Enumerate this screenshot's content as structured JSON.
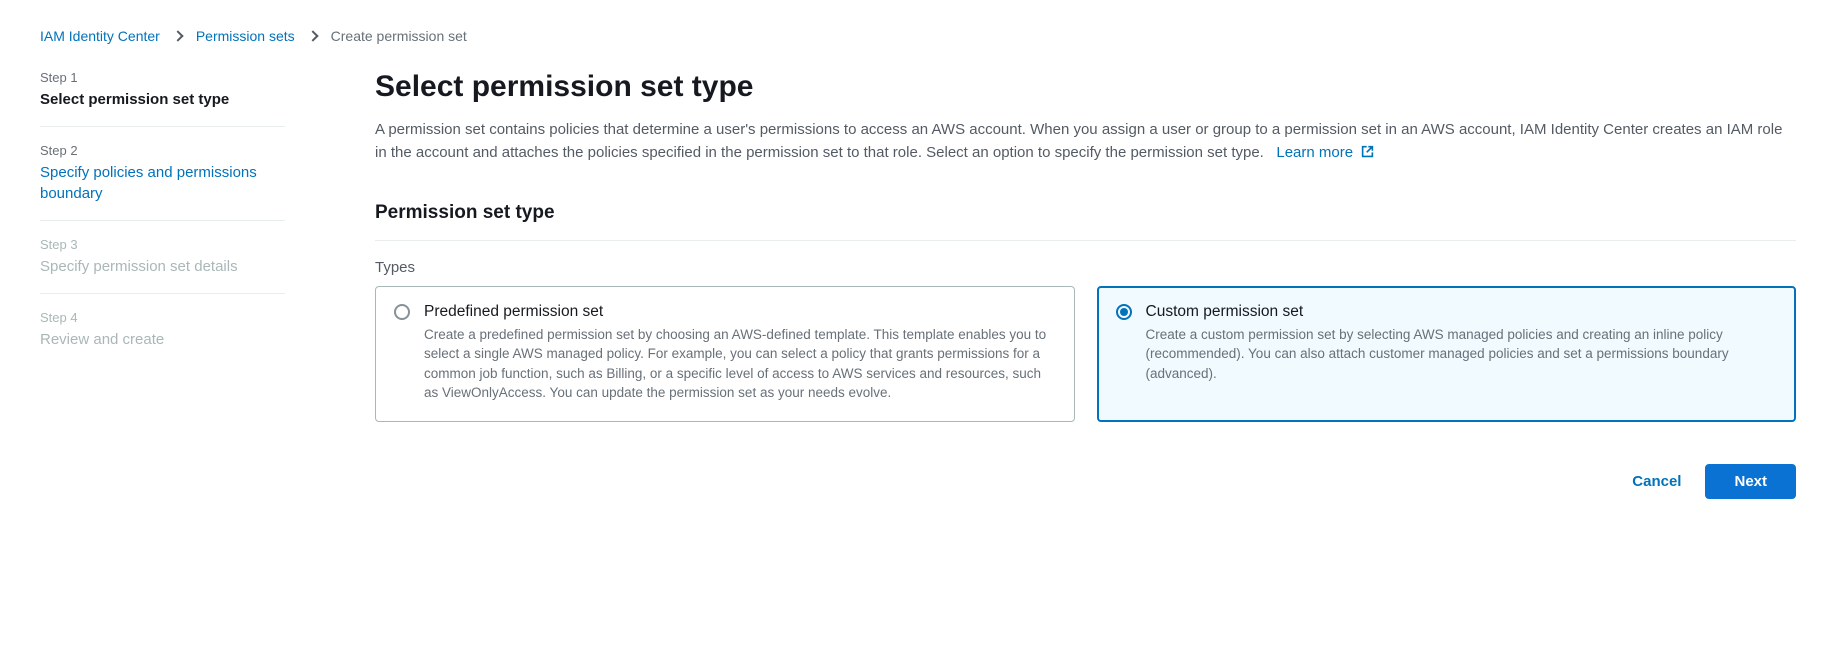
{
  "breadcrumbs": {
    "a": "IAM Identity Center",
    "b": "Permission sets",
    "current": "Create permission set"
  },
  "steps": [
    {
      "num": "Step 1",
      "title": "Select permission set type",
      "state": "active"
    },
    {
      "num": "Step 2",
      "title": "Specify policies and permissions boundary",
      "state": "upcoming"
    },
    {
      "num": "Step 3",
      "title": "Specify permission set details",
      "state": "disabled"
    },
    {
      "num": "Step 4",
      "title": "Review and create",
      "state": "disabled"
    }
  ],
  "main": {
    "heading": "Select permission set type",
    "intro": "A permission set contains policies that determine a user's permissions to access an AWS account. When you assign a user or group to a permission set in an AWS account, IAM Identity Center creates an IAM role in the account and attaches the policies specified in the permission set to that role. Select an option to specify the permission set type.",
    "learn_more": "Learn more",
    "section_title": "Permission set type",
    "types_label": "Types",
    "options": {
      "predefined": {
        "title": "Predefined permission set",
        "desc": "Create a predefined permission set by choosing an AWS-defined template. This template enables you to select a single AWS managed policy. For example, you can select a policy that grants permissions for a common job function, such as Billing, or a specific level of access to AWS services and resources, such as ViewOnlyAccess. You can update the permission set as your needs evolve."
      },
      "custom": {
        "title": "Custom permission set",
        "desc": "Create a custom permission set by selecting AWS managed policies and creating an inline policy (recommended). You can also attach customer managed policies and set a permissions boundary (advanced)."
      },
      "selected": "custom"
    }
  },
  "buttons": {
    "cancel": "Cancel",
    "next": "Next"
  }
}
